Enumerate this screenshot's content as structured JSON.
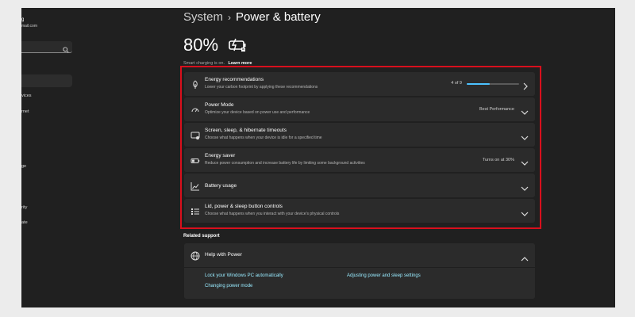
{
  "sidebar": {
    "user_name": "g",
    "user_email": "mail.com",
    "items": [
      "vices",
      "rnet",
      "ge",
      "rity",
      "ate"
    ]
  },
  "header": {
    "breadcrumb_root": "System",
    "breadcrumb_separator": "›",
    "page_title": "Power & battery"
  },
  "battery": {
    "percent": "80%",
    "smart_charging_text": "Smart charging is on.",
    "learn_more": "Learn more"
  },
  "settings": [
    {
      "icon": "leaf-icon",
      "title": "Energy recommendations",
      "description": "Lower your carbon footprint by applying these recommendations",
      "right_text": "4 of 9",
      "progress_fraction": 0.44,
      "chevron": "right"
    },
    {
      "icon": "power-mode-icon",
      "title": "Power Mode",
      "description": "Optimize your device based on power use and performance",
      "right_text": "Best Performance",
      "chevron": "down"
    },
    {
      "icon": "screen-sleep-icon",
      "title": "Screen, sleep, & hibernate timeouts",
      "description": "Choose what happens when your device is idle for a specified time",
      "right_text": "",
      "chevron": "down"
    },
    {
      "icon": "energy-saver-icon",
      "title": "Energy saver",
      "description": "Reduce power consumption and increase battery life by limiting some background activities",
      "right_text": "Turns on at 30%",
      "chevron": "down"
    },
    {
      "icon": "battery-usage-icon",
      "title": "Battery usage",
      "description": "",
      "right_text": "",
      "chevron": "down"
    },
    {
      "icon": "lid-power-icon",
      "title": "Lid, power & sleep button controls",
      "description": "Choose what happens when you interact with your device's physical controls",
      "right_text": "",
      "chevron": "down"
    }
  ],
  "related_support": {
    "title": "Related support",
    "help_title": "Help with Power",
    "links": [
      "Lock your Windows PC automatically",
      "Adjusting power and sleep settings",
      "Changing power mode"
    ]
  },
  "colors": {
    "background": "#202020",
    "card": "#2b2b2b",
    "accent": "#4cc2ff",
    "highlight_border": "#d90f1c",
    "link": "#99ebff"
  }
}
